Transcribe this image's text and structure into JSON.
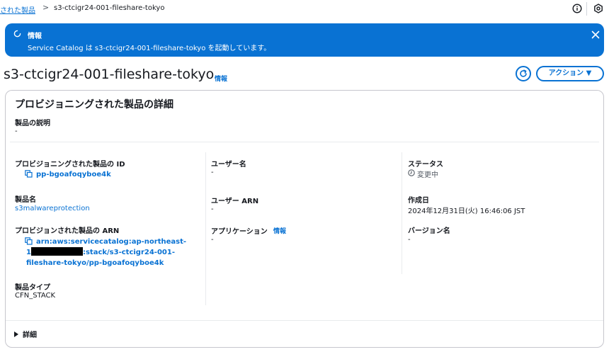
{
  "breadcrumb": {
    "parent_label": "された製品",
    "separator": ">",
    "current_label": "s3-ctcigr24-001-fileshare-tokyo"
  },
  "flash": {
    "title": "情報",
    "message": "Service Catalog は s3-ctcigr24-001-fileshare-tokyo を起動しています。"
  },
  "header": {
    "title": "s3-ctcigr24-001-fileshare-tokyo",
    "info": "情報",
    "actions_label": "アクション ▼"
  },
  "details": {
    "section_title": "プロビジョニングされた製品の詳細",
    "description_label": "製品の説明",
    "description_value": "-",
    "provisioned_id_label": "プロビジョニングされた製品の ID",
    "provisioned_id_value": "pp-bgoafoqyboe4k",
    "product_name_label": "製品名",
    "product_name_value": "s3malwareprotection",
    "arn_label": "プロビジョンされた製品の ARN",
    "arn_line1": "arn:aws:servicecatalog:ap-northeast-",
    "arn_line2_prefix": "1",
    "arn_line2_suffix": ":stack/s3-ctcigr24-001-",
    "arn_line3": "fileshare-tokyo/pp-bgoafoqyboe4k",
    "product_type_label": "製品タイプ",
    "product_type_value": "CFN_STACK",
    "username_label": "ユーザー名",
    "username_value": "-",
    "user_arn_label": "ユーザー ARN",
    "user_arn_value": "-",
    "application_label": "アプリケーション",
    "application_info": "情報",
    "application_value": "-",
    "status_label": "ステータス",
    "status_value": "変更中",
    "created_label": "作成日",
    "created_value": "2024年12月31日(火) 16:46:06 JST",
    "version_label": "バージョン名",
    "version_value": "-",
    "expand_label": "詳細"
  },
  "colors": {
    "accent": "#0972d3",
    "flash_bg": "#0972d3",
    "text": "#16191f"
  }
}
